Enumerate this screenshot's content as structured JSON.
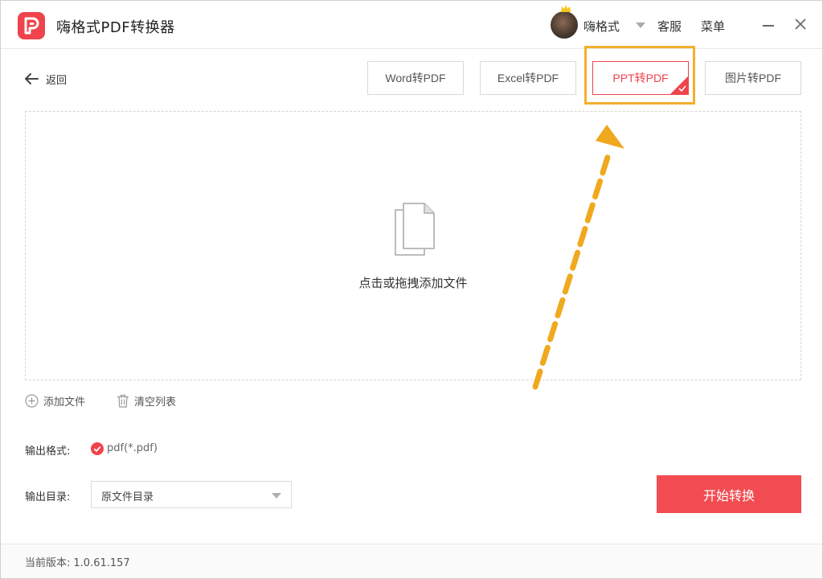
{
  "app": {
    "title": "嗨格式PDF转换器",
    "username": "嗨格式",
    "service_label": "客服",
    "menu_label": "菜单"
  },
  "nav": {
    "back_label": "返回"
  },
  "tabs": [
    {
      "label": "Word转PDF",
      "active": false
    },
    {
      "label": "Excel转PDF",
      "active": false
    },
    {
      "label": "PPT转PDF",
      "active": true
    },
    {
      "label": "图片转PDF",
      "active": false
    }
  ],
  "dropzone": {
    "hint": "点击或拖拽添加文件"
  },
  "actions": {
    "add_file": "添加文件",
    "clear_list": "清空列表"
  },
  "output": {
    "format_label": "输出格式:",
    "format_value": "pdf(*.pdf)",
    "dir_label": "输出目录:",
    "dir_value": "原文件目录"
  },
  "start_button": "开始转换",
  "footer": {
    "version_label": "当前版本:",
    "version_value": "1.0.61.157"
  },
  "colors": {
    "accent": "#f0434c",
    "highlight": "#f2b02c",
    "arrow": "#f0a91e"
  },
  "icons": {
    "logo": "app-logo-icon",
    "back": "arrow-left-icon",
    "file": "file-copy-icon",
    "add": "plus-circle-icon",
    "clear": "trash-icon",
    "check": "check-circle-icon",
    "close": "close-icon",
    "minimize": "minimize-icon"
  }
}
